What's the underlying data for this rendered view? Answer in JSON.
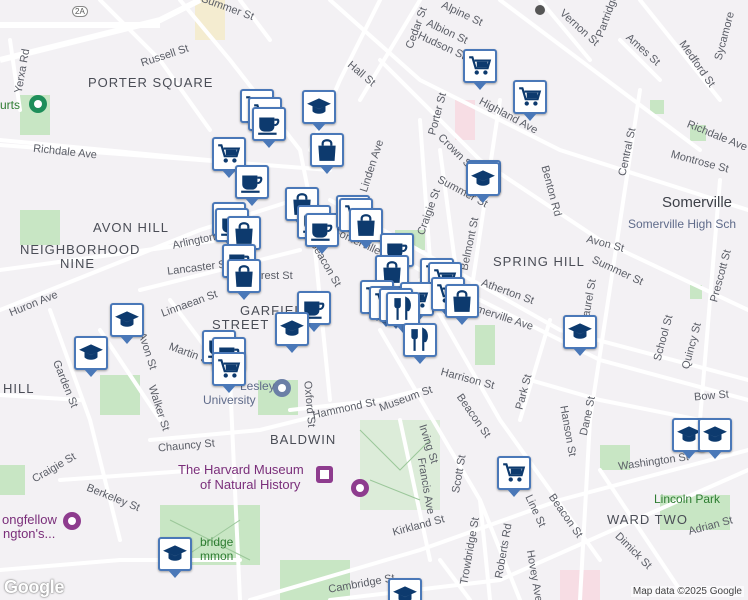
{
  "map": {
    "neighborhoods": [
      {
        "text": "PORTER SQUARE",
        "name": "label-porter-square"
      },
      {
        "text": "AVON HILL",
        "name": "label-avon-hill"
      },
      {
        "text": "NEIGHBORHOOD",
        "name": "label-neighborhood"
      },
      {
        "text": "NINE",
        "name": "label-nine"
      },
      {
        "text": "SPRING HILL",
        "name": "label-spring-hill"
      },
      {
        "text": "BALDWIN",
        "name": "label-baldwin"
      },
      {
        "text": "WARD TWO",
        "name": "label-ward-two"
      },
      {
        "text": "GARFIELD",
        "name": "label-garfield"
      },
      {
        "text": "STREET",
        "name": "label-street"
      },
      {
        "text": "HILL",
        "name": "label-hill"
      }
    ],
    "cities": [
      {
        "text": "Somerville",
        "name": "label-somerville"
      }
    ],
    "pois": [
      {
        "text": "The Harvard Museum",
        "name": "label-harvard-museum-1"
      },
      {
        "text": "of Natural History",
        "name": "label-harvard-museum-2"
      },
      {
        "text": "Lesley",
        "name": "label-lesley"
      },
      {
        "text": "University",
        "name": "label-university"
      },
      {
        "text": "Somerville High Sch",
        "name": "label-somerville-high"
      },
      {
        "text": "Lincoln Park",
        "name": "label-lincoln-park"
      },
      {
        "text": "ongfellow",
        "name": "label-longfellow-1"
      },
      {
        "text": "ngton's...",
        "name": "label-longfellow-2"
      },
      {
        "text": "bridge",
        "name": "label-cambridge-common-1"
      },
      {
        "text": "mmon",
        "name": "label-cambridge-common-2"
      },
      {
        "text": "urts",
        "name": "label-courts"
      }
    ],
    "streets": [
      {
        "text": "Russell St",
        "name": "street-russell"
      },
      {
        "text": "Richdale Ave",
        "name": "street-richdale-west"
      },
      {
        "text": "Richdale Ave",
        "name": "street-richdale-east"
      },
      {
        "text": "Arlington St",
        "name": "street-arlington"
      },
      {
        "text": "Lancaster St",
        "name": "street-lancaster"
      },
      {
        "text": "Linnaean St",
        "name": "street-linnaean"
      },
      {
        "text": "Huron Ave",
        "name": "street-huron"
      },
      {
        "text": "Avon St",
        "name": "street-avon-west"
      },
      {
        "text": "Martin St",
        "name": "street-martin"
      },
      {
        "text": "Garden St",
        "name": "street-garden"
      },
      {
        "text": "Walker St",
        "name": "street-walker"
      },
      {
        "text": "Chauncy St",
        "name": "street-chauncy"
      },
      {
        "text": "Craigie St",
        "name": "street-craigie-west"
      },
      {
        "text": "Berkeley St",
        "name": "street-berkeley"
      },
      {
        "text": "Hammond St",
        "name": "street-hammond"
      },
      {
        "text": "Oxford St",
        "name": "street-oxford"
      },
      {
        "text": "Museum St",
        "name": "street-museum"
      },
      {
        "text": "Irving St",
        "name": "street-irving"
      },
      {
        "text": "Francis Ave",
        "name": "street-francis"
      },
      {
        "text": "Scott St",
        "name": "street-scott"
      },
      {
        "text": "Beacon St",
        "name": "street-beacon-south"
      },
      {
        "text": "Beacon St",
        "name": "street-beacon-east"
      },
      {
        "text": "Harrison St",
        "name": "street-harrison"
      },
      {
        "text": "Summer St",
        "name": "street-summer-1"
      },
      {
        "text": "Summer St",
        "name": "street-summer-2"
      },
      {
        "text": "Summer St",
        "name": "street-summer-top"
      },
      {
        "text": "Somerville Ave",
        "name": "street-somerville-ave"
      },
      {
        "text": "Atherton St",
        "name": "street-atherton"
      },
      {
        "text": "Park St",
        "name": "street-park"
      },
      {
        "text": "Laurel St",
        "name": "street-laurel"
      },
      {
        "text": "School St",
        "name": "street-school"
      },
      {
        "text": "Quincy St",
        "name": "street-quincy"
      },
      {
        "text": "Prescott St",
        "name": "street-prescott"
      },
      {
        "text": "Bow St",
        "name": "street-bow"
      },
      {
        "text": "Dane St",
        "name": "street-dane"
      },
      {
        "text": "Hanson St",
        "name": "street-hanson"
      },
      {
        "text": "Washington St",
        "name": "street-washington"
      },
      {
        "text": "Kirkland St",
        "name": "street-kirkland"
      },
      {
        "text": "Line St",
        "name": "street-line"
      },
      {
        "text": "Hovey Ave",
        "name": "street-hovey"
      },
      {
        "text": "Roberts Rd",
        "name": "street-roberts"
      },
      {
        "text": "Trowbridge St",
        "name": "street-trowbridge"
      },
      {
        "text": "Dimick St",
        "name": "street-dimick"
      },
      {
        "text": "Adrian St",
        "name": "street-adrian"
      },
      {
        "text": "Avon St",
        "name": "street-avon-east"
      },
      {
        "text": "Central St",
        "name": "street-central"
      },
      {
        "text": "Montrose St",
        "name": "street-montrose"
      },
      {
        "text": "Benton Rd",
        "name": "street-benton"
      },
      {
        "text": "Highland Ave",
        "name": "street-highland"
      },
      {
        "text": "Crown St",
        "name": "street-crown"
      },
      {
        "text": "Porter St",
        "name": "street-porter"
      },
      {
        "text": "Craigie St",
        "name": "street-craigie-east"
      },
      {
        "text": "Belmont St",
        "name": "street-belmont"
      },
      {
        "text": "Linden Ave",
        "name": "street-linden"
      },
      {
        "text": "Hall St",
        "name": "street-hall"
      },
      {
        "text": "Cedar St",
        "name": "street-cedar"
      },
      {
        "text": "Albion St",
        "name": "street-albion"
      },
      {
        "text": "Alpine St",
        "name": "street-alpine"
      },
      {
        "text": "Hudson St",
        "name": "street-hudson"
      },
      {
        "text": "Vernon St",
        "name": "street-vernon"
      },
      {
        "text": "Ames St",
        "name": "street-ames"
      },
      {
        "text": "Medford St",
        "name": "street-medford"
      },
      {
        "text": "Partridge",
        "name": "street-partridge"
      },
      {
        "text": "Sycamore",
        "name": "street-sycamore"
      },
      {
        "text": "Cambridge St",
        "name": "street-cambridge"
      },
      {
        "text": "Yerxa Rd",
        "name": "street-yerxa"
      },
      {
        "text": "Beacon St",
        "name": "street-beacon-north"
      },
      {
        "text": "Forest St",
        "name": "street-forest"
      },
      {
        "text": "Somerville Ave",
        "name": "street-somerville-ave-west"
      }
    ],
    "markers": [
      {
        "type": "grocery",
        "name": "marker-grocery"
      },
      {
        "type": "school",
        "name": "marker-school"
      },
      {
        "type": "cafe",
        "name": "marker-cafe"
      },
      {
        "type": "shopping",
        "name": "marker-shopping"
      },
      {
        "type": "restaurant",
        "name": "marker-restaurant"
      }
    ],
    "route_badge": "2A",
    "attribution": "Map data ©2025 Google",
    "logo": "Google",
    "colors": {
      "marker_border": "#4a78b8",
      "marker_icon": "#0d3a6e",
      "park": "#c8e6c4",
      "background": "#f3f1f4",
      "road": "#ffffff",
      "pink_area": "#f7dde4"
    }
  }
}
